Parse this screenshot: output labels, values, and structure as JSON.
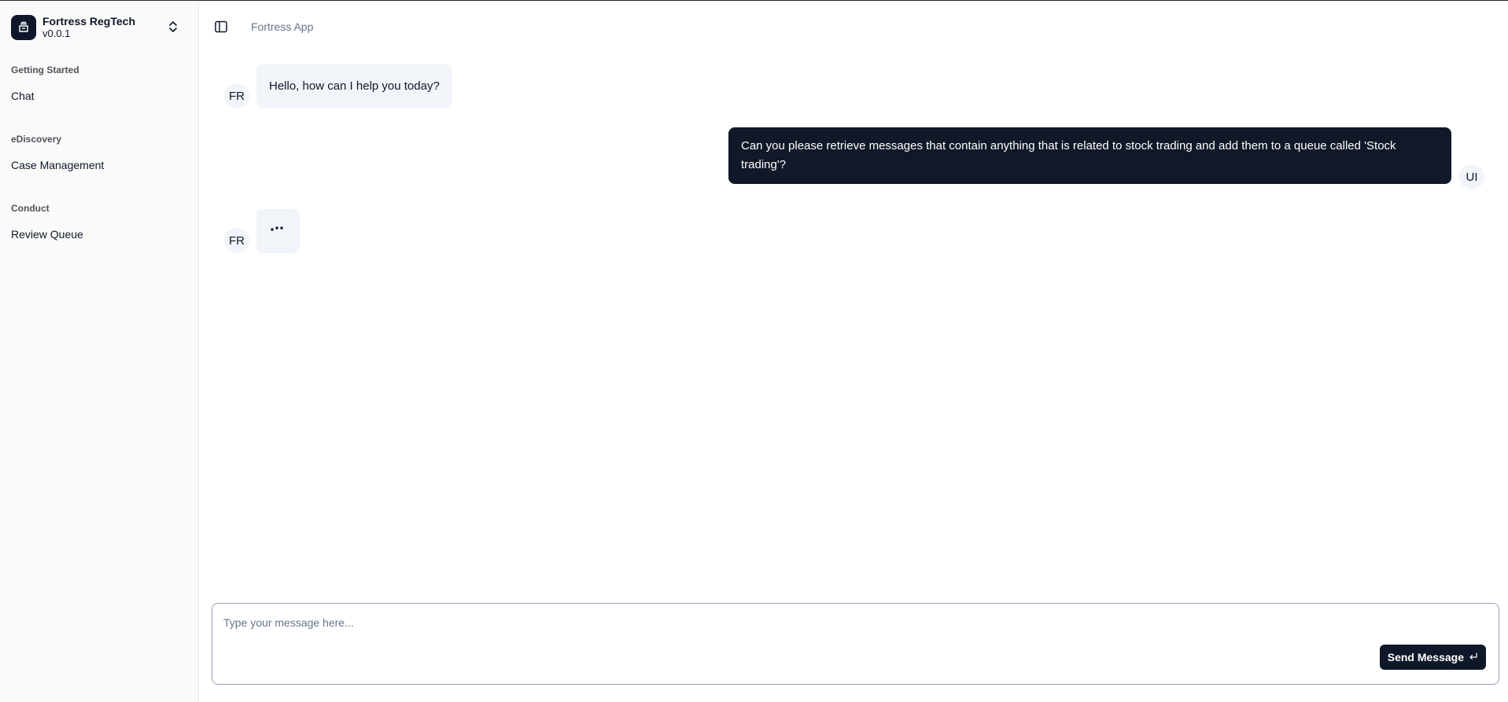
{
  "brand": {
    "name": "Fortress RegTech",
    "version": "v0.0.1"
  },
  "sidebar": {
    "groups": [
      {
        "label": "Getting Started",
        "items": [
          {
            "label": "Chat"
          }
        ]
      },
      {
        "label": "eDiscovery",
        "items": [
          {
            "label": "Case Management"
          }
        ]
      },
      {
        "label": "Conduct",
        "items": [
          {
            "label": "Review Queue"
          }
        ]
      }
    ]
  },
  "header": {
    "breadcrumb": "Fortress App"
  },
  "chat": {
    "messages": [
      {
        "role": "bot",
        "avatar": "FR",
        "text": "Hello, how can I help you today?"
      },
      {
        "role": "user",
        "avatar": "UI",
        "text": "Can you please retrieve messages that contain anything that is related to stock trading and add them to a queue called 'Stock trading'?"
      },
      {
        "role": "bot",
        "avatar": "FR",
        "text": "",
        "typing": true
      }
    ]
  },
  "composer": {
    "placeholder": "Type your message here...",
    "value": "",
    "send_label": "Send Message"
  },
  "icons": {
    "brand": "database-icon",
    "chevron": "chevrons-up-down-icon",
    "sidebar_toggle": "panel-left-icon",
    "send": "enter-icon"
  },
  "colors": {
    "primary": "#0f172a",
    "user_bubble": "#111827",
    "bot_bubble": "#f1f5f9",
    "sidebar_bg": "#fafafa"
  }
}
